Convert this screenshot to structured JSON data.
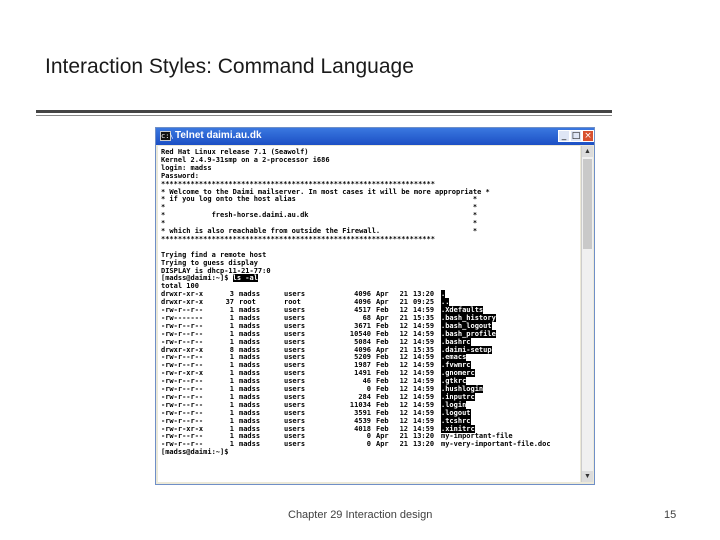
{
  "slide": {
    "title": "Interaction Styles: Command Language",
    "footer": "Chapter 29 Interaction design",
    "page_number": "15"
  },
  "window": {
    "title": "Telnet daimi.au.dk",
    "icon": "terminal-icon",
    "min": "_",
    "max": "□",
    "close": "×"
  },
  "terminal": {
    "header_lines": [
      "Red Hat Linux release 7.1 (Seawolf)",
      "Kernel 2.4.9-31smp on a 2-processor i686",
      "login: madss",
      "Password:",
      "*****************************************************************",
      "* Welcome to the Daimi mailserver. In most cases it will be more appropriate *",
      "* if you log onto the host alias                                          *",
      "*                                                                         *",
      "*           fresh-horse.daimi.au.dk                                       *",
      "*                                                                         *",
      "* which is also reachable from outside the Firewall.                      *",
      "*****************************************************************",
      "",
      "Trying find a remote host",
      "Trying to guess display",
      "DISPLAY is dhcp-11-21-77:0"
    ],
    "prompt": "[madss@daimi:~]$",
    "command": "ls -al",
    "total": "total 100",
    "listing": [
      {
        "perm": "drwxr-xr-x",
        "links": "3",
        "owner": "madss",
        "group": "users",
        "size": "4096",
        "mon": "Apr",
        "day": "21",
        "time": "13:20",
        "name": ".",
        "hl": true
      },
      {
        "perm": "drwxr-xr-x",
        "links": "37",
        "owner": "root",
        "group": "root",
        "size": "4096",
        "mon": "Apr",
        "day": "21",
        "time": "09:25",
        "name": "..",
        "hl": true
      },
      {
        "perm": "-rw-r--r--",
        "links": "1",
        "owner": "madss",
        "group": "users",
        "size": "4517",
        "mon": "Feb",
        "day": "12",
        "time": "14:59",
        "name": ".Xdefaults",
        "hl": true
      },
      {
        "perm": "-rw-------",
        "links": "1",
        "owner": "madss",
        "group": "users",
        "size": "68",
        "mon": "Apr",
        "day": "21",
        "time": "15:35",
        "name": ".bash_history",
        "hl": true
      },
      {
        "perm": "-rw-r--r--",
        "links": "1",
        "owner": "madss",
        "group": "users",
        "size": "3671",
        "mon": "Feb",
        "day": "12",
        "time": "14:59",
        "name": ".bash_logout",
        "hl": true
      },
      {
        "perm": "-rw-r--r--",
        "links": "1",
        "owner": "madss",
        "group": "users",
        "size": "10540",
        "mon": "Feb",
        "day": "12",
        "time": "14:59",
        "name": ".bash_profile",
        "hl": true
      },
      {
        "perm": "-rw-r--r--",
        "links": "1",
        "owner": "madss",
        "group": "users",
        "size": "5084",
        "mon": "Feb",
        "day": "12",
        "time": "14:59",
        "name": ".bashrc",
        "hl": true
      },
      {
        "perm": "drwxr-xr-x",
        "links": "8",
        "owner": "madss",
        "group": "users",
        "size": "4096",
        "mon": "Apr",
        "day": "21",
        "time": "15:35",
        "name": ".daimi-setup",
        "hl": true
      },
      {
        "perm": "-rw-r--r--",
        "links": "1",
        "owner": "madss",
        "group": "users",
        "size": "5209",
        "mon": "Feb",
        "day": "12",
        "time": "14:59",
        "name": ".emacs",
        "hl": true
      },
      {
        "perm": "-rw-r--r--",
        "links": "1",
        "owner": "madss",
        "group": "users",
        "size": "1987",
        "mon": "Feb",
        "day": "12",
        "time": "14:59",
        "name": ".fvwmrc",
        "hl": true
      },
      {
        "perm": "-rw-r-xr-x",
        "links": "1",
        "owner": "madss",
        "group": "users",
        "size": "1491",
        "mon": "Feb",
        "day": "12",
        "time": "14:59",
        "name": ".gnomerc",
        "hl": true
      },
      {
        "perm": "-rw-r--r--",
        "links": "1",
        "owner": "madss",
        "group": "users",
        "size": "46",
        "mon": "Feb",
        "day": "12",
        "time": "14:59",
        "name": ".gtkrc",
        "hl": true
      },
      {
        "perm": "-rw-r--r--",
        "links": "1",
        "owner": "madss",
        "group": "users",
        "size": "0",
        "mon": "Feb",
        "day": "12",
        "time": "14:59",
        "name": ".hushlogin",
        "hl": true
      },
      {
        "perm": "-rw-r--r--",
        "links": "1",
        "owner": "madss",
        "group": "users",
        "size": "284",
        "mon": "Feb",
        "day": "12",
        "time": "14:59",
        "name": ".inputrc",
        "hl": true
      },
      {
        "perm": "-rw-r--r--",
        "links": "1",
        "owner": "madss",
        "group": "users",
        "size": "11034",
        "mon": "Feb",
        "day": "12",
        "time": "14:59",
        "name": ".login",
        "hl": true
      },
      {
        "perm": "-rw-r--r--",
        "links": "1",
        "owner": "madss",
        "group": "users",
        "size": "3591",
        "mon": "Feb",
        "day": "12",
        "time": "14:59",
        "name": ".logout",
        "hl": true
      },
      {
        "perm": "-rw-r--r--",
        "links": "1",
        "owner": "madss",
        "group": "users",
        "size": "4539",
        "mon": "Feb",
        "day": "12",
        "time": "14:59",
        "name": ".tcshrc",
        "hl": true
      },
      {
        "perm": "-rw-r-xr-x",
        "links": "1",
        "owner": "madss",
        "group": "users",
        "size": "4018",
        "mon": "Feb",
        "day": "12",
        "time": "14:59",
        "name": ".xinitrc",
        "hl": true
      },
      {
        "perm": "-rw-r--r--",
        "links": "1",
        "owner": "madss",
        "group": "users",
        "size": "0",
        "mon": "Apr",
        "day": "21",
        "time": "13:20",
        "name": "my-important-file",
        "hl": false
      },
      {
        "perm": "-rw-r--r--",
        "links": "1",
        "owner": "madss",
        "group": "users",
        "size": "0",
        "mon": "Apr",
        "day": "21",
        "time": "13:20",
        "name": "my-very-important-file.doc",
        "hl": false
      }
    ],
    "final_prompt": "[madss@daimi:~]$"
  }
}
